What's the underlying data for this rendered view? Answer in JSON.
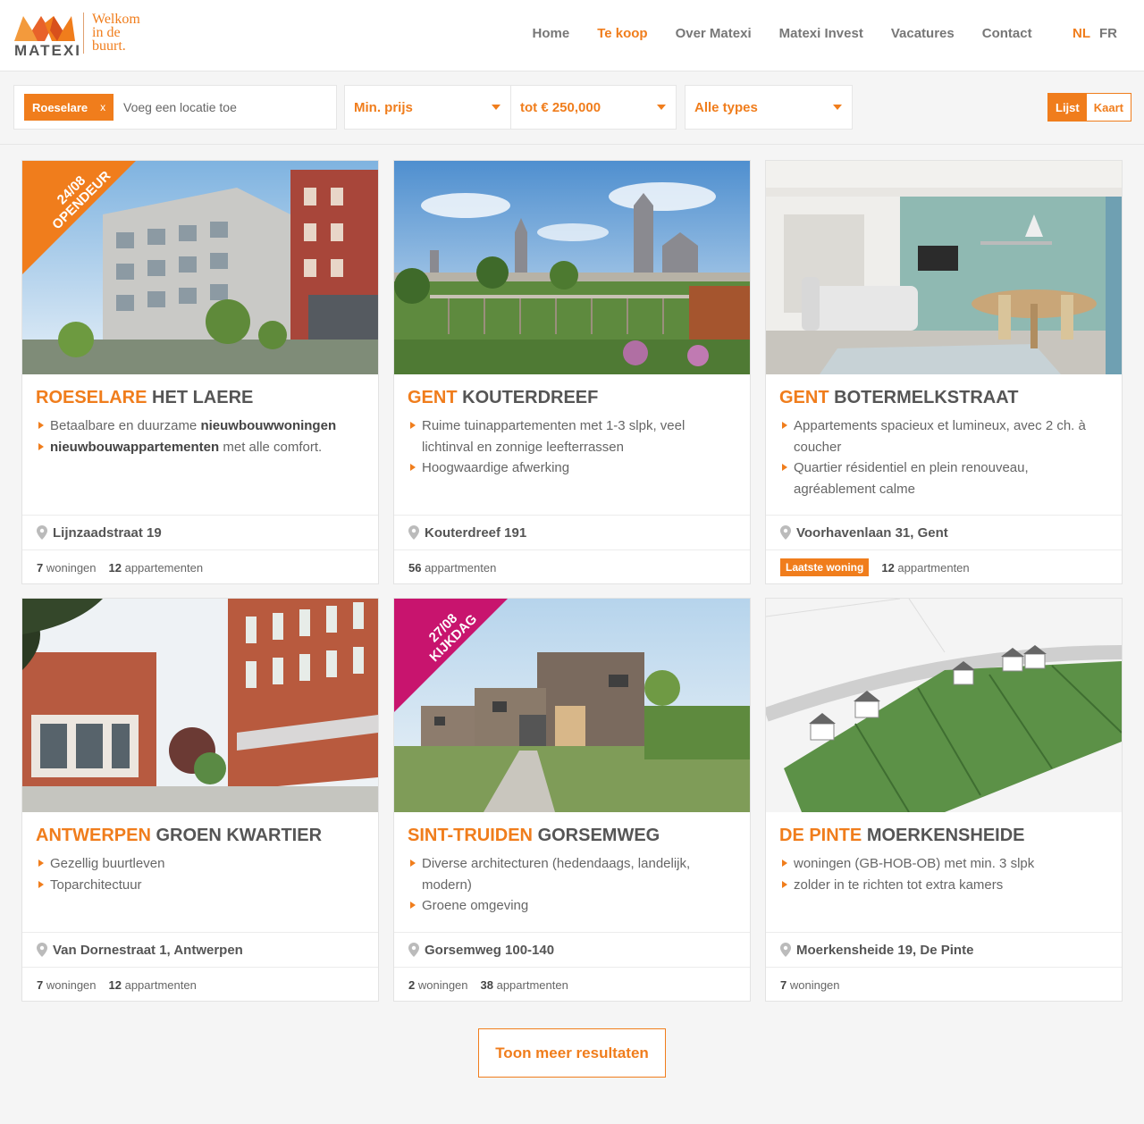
{
  "brand": {
    "logo_word": "MATEXI",
    "slogan_lines": [
      "Welkom",
      "in de",
      "buurt."
    ],
    "accent": "#f07d1c"
  },
  "nav": {
    "items": [
      {
        "label": "Home"
      },
      {
        "label": "Te koop"
      },
      {
        "label": "Over Matexi"
      },
      {
        "label": "Matexi Invest"
      },
      {
        "label": "Vacatures"
      },
      {
        "label": "Contact"
      }
    ],
    "active": "Te koop",
    "languages": [
      "NL",
      "FR"
    ],
    "active_language": "NL"
  },
  "filters": {
    "location_chip": "Roeselare",
    "chip_remove": "x",
    "location_placeholder": "Voeg een locatie toe",
    "min_price": "Min. prijs",
    "max_price": "tot € 250,000",
    "types": "Alle types",
    "view_list": "Lijst",
    "view_map": "Kaart"
  },
  "projects": [
    {
      "city": "ROESELARE",
      "name": "HET LAERE",
      "ribbon": {
        "date": "24/08",
        "label": "OPENDEUR",
        "color": "#f07d1c"
      },
      "bullets": [
        {
          "pre": "Betaalbare en duurzame ",
          "bold": "nieuwbouwwoningen",
          "post": ""
        },
        {
          "pre": "",
          "bold": "nieuwbouwappartementen",
          "post": " met alle comfort."
        }
      ],
      "address": "Lijnzaadstraat 19",
      "badge": "",
      "stats": [
        {
          "n": "7",
          "label": " woningen"
        },
        {
          "n": "12",
          "label": " appartementen"
        }
      ]
    },
    {
      "city": "GENT",
      "name": "KOUTERDREEF",
      "ribbon": null,
      "bullets": [
        {
          "pre": "Ruime tuinappartementen met 1-3 slpk, veel lichtinval en zonnige leefterrassen",
          "bold": "",
          "post": ""
        },
        {
          "pre": "Hoogwaardige afwerking",
          "bold": "",
          "post": ""
        }
      ],
      "address": "Kouterdreef 191",
      "badge": "",
      "stats": [
        {
          "n": "56",
          "label": " appartmenten"
        }
      ]
    },
    {
      "city": "GENT",
      "name": "BOTERMELKSTRAAT",
      "ribbon": null,
      "bullets": [
        {
          "pre": "Appartements spacieux et lumineux, avec 2 ch. à coucher",
          "bold": "",
          "post": ""
        },
        {
          "pre": "Quartier résidentiel en plein renouveau, agréablement calme",
          "bold": "",
          "post": ""
        }
      ],
      "address": "Voorhavenlaan 31, Gent",
      "badge": "Laatste woning",
      "stats": [
        {
          "n": "12",
          "label": " appartmenten"
        }
      ]
    },
    {
      "city": "ANTWERPEN",
      "name": "GROEN KWARTIER",
      "ribbon": null,
      "bullets": [
        {
          "pre": "Gezellig buurtleven",
          "bold": "",
          "post": ""
        },
        {
          "pre": "Toparchitectuur",
          "bold": "",
          "post": ""
        }
      ],
      "address": "Van Dornestraat 1, Antwerpen",
      "badge": "",
      "stats": [
        {
          "n": "7",
          "label": " woningen"
        },
        {
          "n": "12",
          "label": " appartmenten"
        }
      ]
    },
    {
      "city": "SINT-TRUIDEN",
      "name": "GORSEMWEG",
      "ribbon": {
        "date": "27/08",
        "label": "KIJKDAG",
        "color": "#c8146e"
      },
      "bullets": [
        {
          "pre": "Diverse architecturen (hedendaags, landelijk, modern)",
          "bold": "",
          "post": ""
        },
        {
          "pre": "Groene omgeving",
          "bold": "",
          "post": ""
        }
      ],
      "address": "Gorsemweg 100-140",
      "badge": "",
      "stats": [
        {
          "n": "2",
          "label": " woningen"
        },
        {
          "n": "38",
          "label": " appartmenten"
        }
      ]
    },
    {
      "city": "DE PINTE",
      "name": "MOERKENSHEIDE",
      "ribbon": null,
      "bullets": [
        {
          "pre": "woningen (GB-HOB-OB) met min. 3 slpk",
          "bold": "",
          "post": ""
        },
        {
          "pre": "zolder in te richten tot extra kamers",
          "bold": "",
          "post": ""
        }
      ],
      "address": "Moerkensheide 19, De Pinte",
      "badge": "",
      "stats": [
        {
          "n": "7",
          "label": " woningen"
        }
      ]
    }
  ],
  "more_button": "Toon meer resultaten"
}
